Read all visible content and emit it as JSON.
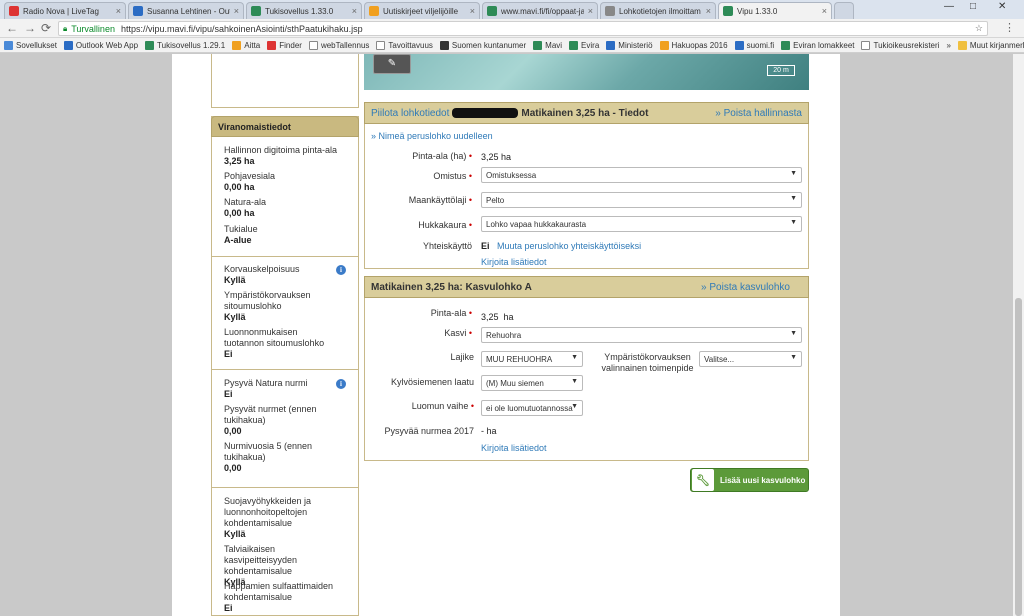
{
  "browser": {
    "tabs": [
      {
        "label": "Radio Nova | LiveTag",
        "color": "#d33"
      },
      {
        "label": "Susanna Lehtinen - Outl",
        "color": "#2b6cc4"
      },
      {
        "label": "Tukisovellus 1.33.0",
        "color": "#2e8b57"
      },
      {
        "label": "Uutiskirjeet viljelijöille",
        "color": "#f0a020"
      },
      {
        "label": "www.mavi.fi/fi/oppaat-ja",
        "color": "#2e8b57"
      },
      {
        "label": "Lohkotietojen ilmoittam",
        "color": "#888"
      },
      {
        "label": "Vipu 1.33.0",
        "color": "#2e8b57"
      }
    ],
    "secure_label": "Turvallinen",
    "url": "https://vipu.mavi.fi/vipu/sahkoinenAsiointi/sthPaatukihaku.jsp",
    "bookmarks": [
      {
        "label": "Sovellukset",
        "color": "#4a8ad8"
      },
      {
        "label": "Outlook Web App",
        "color": "#2b6cc4"
      },
      {
        "label": "Tukisovellus 1.29.1",
        "color": "#2e8b57"
      },
      {
        "label": "Aitta",
        "color": "#f0a020"
      },
      {
        "label": "Finder",
        "color": "#d33"
      },
      {
        "label": "webTallennus",
        "color": "#888"
      },
      {
        "label": "Tavoittavuus",
        "color": "#888"
      },
      {
        "label": "Suomen kuntanumer",
        "color": "#333"
      },
      {
        "label": "Mavi",
        "color": "#2e8b57"
      },
      {
        "label": "Evira",
        "color": "#2e8b57"
      },
      {
        "label": "Ministeriö",
        "color": "#2b6cc4"
      },
      {
        "label": "Hakuopas 2016",
        "color": "#f0a020"
      },
      {
        "label": "suomi.fi",
        "color": "#2b6cc4"
      },
      {
        "label": "Eviran lomakkeet",
        "color": "#2e8b57"
      },
      {
        "label": "Tukioikeusrekisteri",
        "color": "#888"
      }
    ],
    "more_bookmarks": "»",
    "other_bookmarks": "Muut kirjanmerkit"
  },
  "map": {
    "scale_label": "20 m"
  },
  "sidebar": {
    "header": "Viranomaistiedot",
    "group1": [
      {
        "label": "Hallinnon digitoima pinta-ala",
        "value": "3,25 ha"
      },
      {
        "label": "Pohjavesiala",
        "value": "0,00 ha"
      },
      {
        "label": "Natura-ala",
        "value": "0,00 ha"
      },
      {
        "label": "Tukialue",
        "value": "A-alue"
      }
    ],
    "group2": [
      {
        "label": "Korvauskelpoisuus",
        "value": "Kyllä"
      },
      {
        "label": "Ympäristökorvauksen sitoumuslohko",
        "value": "Kyllä"
      },
      {
        "label": "Luonnonmukaisen tuotannon sitoumuslohko",
        "value": "Ei"
      }
    ],
    "group3": [
      {
        "label": "Pysyvä Natura nurmi",
        "value": "Ei"
      },
      {
        "label": "Pysyvät nurmet (ennen tukihakua)",
        "value": "0,00"
      },
      {
        "label": "Nurmivuosia 5 (ennen tukihakua)",
        "value": "0,00"
      }
    ],
    "group4": [
      {
        "label": "Suojavyöhykkeiden ja luonnonhoitopeltojen kohdentamisalue",
        "value": "Kyllä"
      },
      {
        "label": "Talviaikaisen kasvipeitteisyyden kohdentamisalue",
        "value": "Kyllä"
      },
      {
        "label": "Happamien sulfaattimaiden kohdentamisalue",
        "value": "Ei"
      }
    ]
  },
  "perus": {
    "hide_link": "Piilota lohkotiedot",
    "title": "Matikainen 3,25 ha - Tiedot",
    "remove_link": "» Poista hallinnasta",
    "rename_link": "» Nimeä peruslohko uudelleen",
    "pinta_label": "Pinta-ala (ha)",
    "pinta_value": "3,25 ha",
    "omistus_label": "Omistus",
    "omistus_value": "Omistuksessa",
    "maankaytto_label": "Maankäyttölaji",
    "maankaytto_value": "Pelto",
    "hukka_label": "Hukkakaura",
    "hukka_value": "Lohko vapaa hukkakaurasta",
    "yhteis_label": "Yhteiskäyttö",
    "yhteis_value": "Ei",
    "yhteis_link": "Muuta peruslohko yhteiskäyttöiseksi",
    "lisatiedot_link": "Kirjoita lisätiedot"
  },
  "kasvu": {
    "title": "Matikainen 3,25 ha: Kasvulohko A",
    "remove_link": "» Poista kasvulohko",
    "pinta_label": "Pinta-ala",
    "pinta_value": "3,25",
    "pinta_unit": "ha",
    "kasvi_label": "Kasvi",
    "kasvi_value": "Rehuohra",
    "lajike_label": "Lajike",
    "lajike_value": "MUU REHUOHRA",
    "ymparisto_label": "Ympäristökorvauksen valinnainen toimenpide",
    "ymparisto_value": "Valitse...",
    "kylvo_label": "Kylvösiemenen laatu",
    "kylvo_value": "(M) Muu siemen",
    "luomu_label": "Luomun vaihe",
    "luomu_value": "ei ole luomutuotannossa",
    "pysyva_label": "Pysyvää nurmea 2017",
    "pysyva_value": "- ha",
    "lisatiedot_link": "Kirjoita lisätiedot"
  },
  "add_button": "Lisää uusi kasvulohko"
}
